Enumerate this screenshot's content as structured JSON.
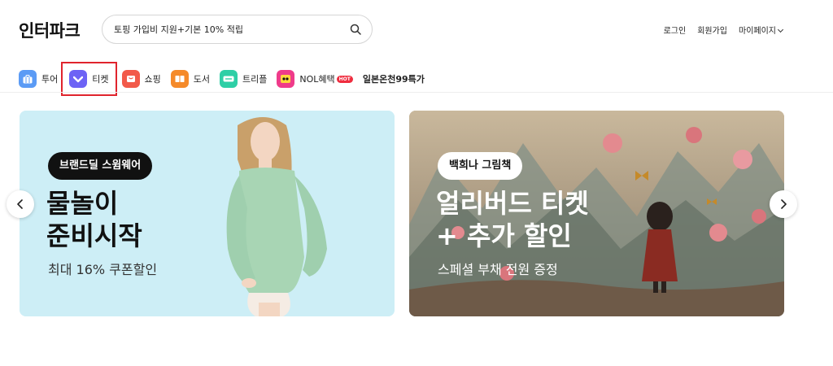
{
  "header": {
    "logo": "인터파크",
    "search_value": "토핑 가입비 지원+기본 10% 적립",
    "links": {
      "login": "로그인",
      "signup": "회원가입",
      "mypage": "마이페이지"
    }
  },
  "nav": {
    "items": [
      {
        "label": "투어",
        "icon": "suitcase-icon",
        "color": "#5b9bf5"
      },
      {
        "label": "티켓",
        "icon": "ticket-icon",
        "color": "#6d63f5"
      },
      {
        "label": "쇼핑",
        "icon": "shopping-bag-icon",
        "color": "#f25a4a"
      },
      {
        "label": "도서",
        "icon": "book-icon",
        "color": "#f58a2a"
      },
      {
        "label": "트리플",
        "icon": "triple-icon",
        "color": "#2ecfa6"
      },
      {
        "label": "NOL혜택",
        "icon": "nol-icon",
        "color": "#ef3b8a",
        "badge": "HOT"
      },
      {
        "label": "일본온천99특가"
      }
    ]
  },
  "banners": [
    {
      "tag": "브랜드딜 스윔웨어",
      "headline_1": "물놀이",
      "headline_2": "준비시작",
      "sub": "최대 16% 쿠폰할인"
    },
    {
      "tag": "백희나 그림책",
      "headline_1": "얼리버드 티켓",
      "headline_2": "+ 추가 할인",
      "sub": "스페셜 부채 전원 증정"
    }
  ],
  "colors": {
    "accent_red": "#e0242d",
    "left_banner_bg": "#cdeef6"
  }
}
